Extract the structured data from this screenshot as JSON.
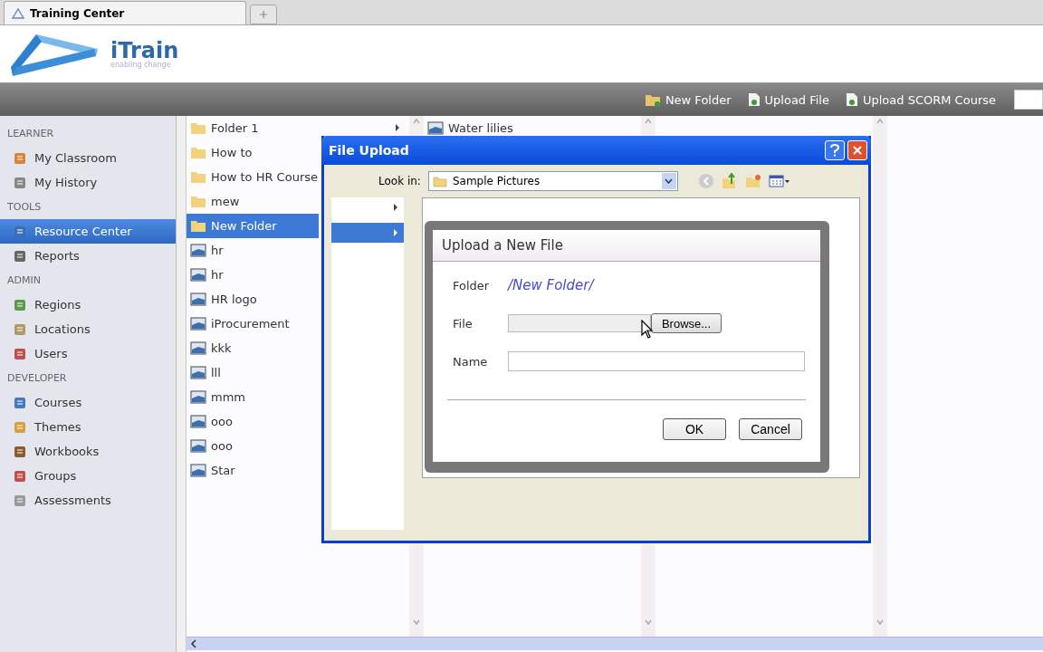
{
  "browser_tab": {
    "title": "Training Center"
  },
  "logo": {
    "name": "iTrain",
    "tagline": "enabling change"
  },
  "toolbar": {
    "actions": [
      {
        "label": "New Folder",
        "kind": "folder"
      },
      {
        "label": "Upload File",
        "kind": "file"
      },
      {
        "label": "Upload SCORM Course",
        "kind": "file"
      }
    ]
  },
  "sidebar": {
    "sections": [
      {
        "heading": "LEARNER",
        "items": [
          {
            "label": "My Classroom",
            "selected": false
          },
          {
            "label": "My History",
            "selected": false
          }
        ]
      },
      {
        "heading": "TOOLS",
        "items": [
          {
            "label": "Resource Center",
            "selected": true
          },
          {
            "label": "Reports",
            "selected": false
          }
        ]
      },
      {
        "heading": "ADMIN",
        "items": [
          {
            "label": "Regions",
            "selected": false
          },
          {
            "label": "Locations",
            "selected": false
          },
          {
            "label": "Users",
            "selected": false
          }
        ]
      },
      {
        "heading": "DEVELOPER",
        "items": [
          {
            "label": "Courses",
            "selected": false
          },
          {
            "label": "Themes",
            "selected": false
          },
          {
            "label": "Workbooks",
            "selected": false
          },
          {
            "label": "Groups",
            "selected": false
          },
          {
            "label": "Assessments",
            "selected": false
          }
        ]
      }
    ]
  },
  "folder_column": {
    "items": [
      {
        "label": "Folder 1",
        "kind": "folder",
        "selected": false,
        "has_children": true
      },
      {
        "label": "How to",
        "kind": "folder",
        "selected": false,
        "has_children": false
      },
      {
        "label": "How to HR Course",
        "kind": "folder",
        "selected": false,
        "has_children": false
      },
      {
        "label": "mew",
        "kind": "folder",
        "selected": false,
        "has_children": false
      },
      {
        "label": "New Folder",
        "kind": "folder",
        "selected": true,
        "has_children": false
      },
      {
        "label": "hr",
        "kind": "image",
        "selected": false,
        "has_children": false
      },
      {
        "label": "hr",
        "kind": "image",
        "selected": false,
        "has_children": false
      },
      {
        "label": "HR logo",
        "kind": "image",
        "selected": false,
        "has_children": false
      },
      {
        "label": "iProcurement",
        "kind": "image",
        "selected": false,
        "has_children": false
      },
      {
        "label": "kkk",
        "kind": "image",
        "selected": false,
        "has_children": false
      },
      {
        "label": "lll",
        "kind": "image",
        "selected": false,
        "has_children": false
      },
      {
        "label": "mmm",
        "kind": "image",
        "selected": false,
        "has_children": false
      },
      {
        "label": "ooo",
        "kind": "image",
        "selected": false,
        "has_children": false
      },
      {
        "label": "ooo",
        "kind": "image",
        "selected": false,
        "has_children": false
      },
      {
        "label": "Star",
        "kind": "image",
        "selected": false,
        "has_children": false
      }
    ]
  },
  "file_column": {
    "items": [
      {
        "label": "Water lilies",
        "kind": "image"
      }
    ]
  },
  "file_dialog": {
    "title": "File Upload",
    "look_in_label": "Look in:",
    "look_in_value": "Sample Pictures",
    "nav_rows": [
      {
        "selected": false
      },
      {
        "selected": true
      }
    ]
  },
  "upload_dialog": {
    "title": "Upload a New File",
    "folder_label": "Folder",
    "folder_value": "/New Folder/",
    "file_label": "File",
    "browse_button": "Browse...",
    "name_label": "Name",
    "ok_button": "OK",
    "cancel_button": "Cancel"
  }
}
